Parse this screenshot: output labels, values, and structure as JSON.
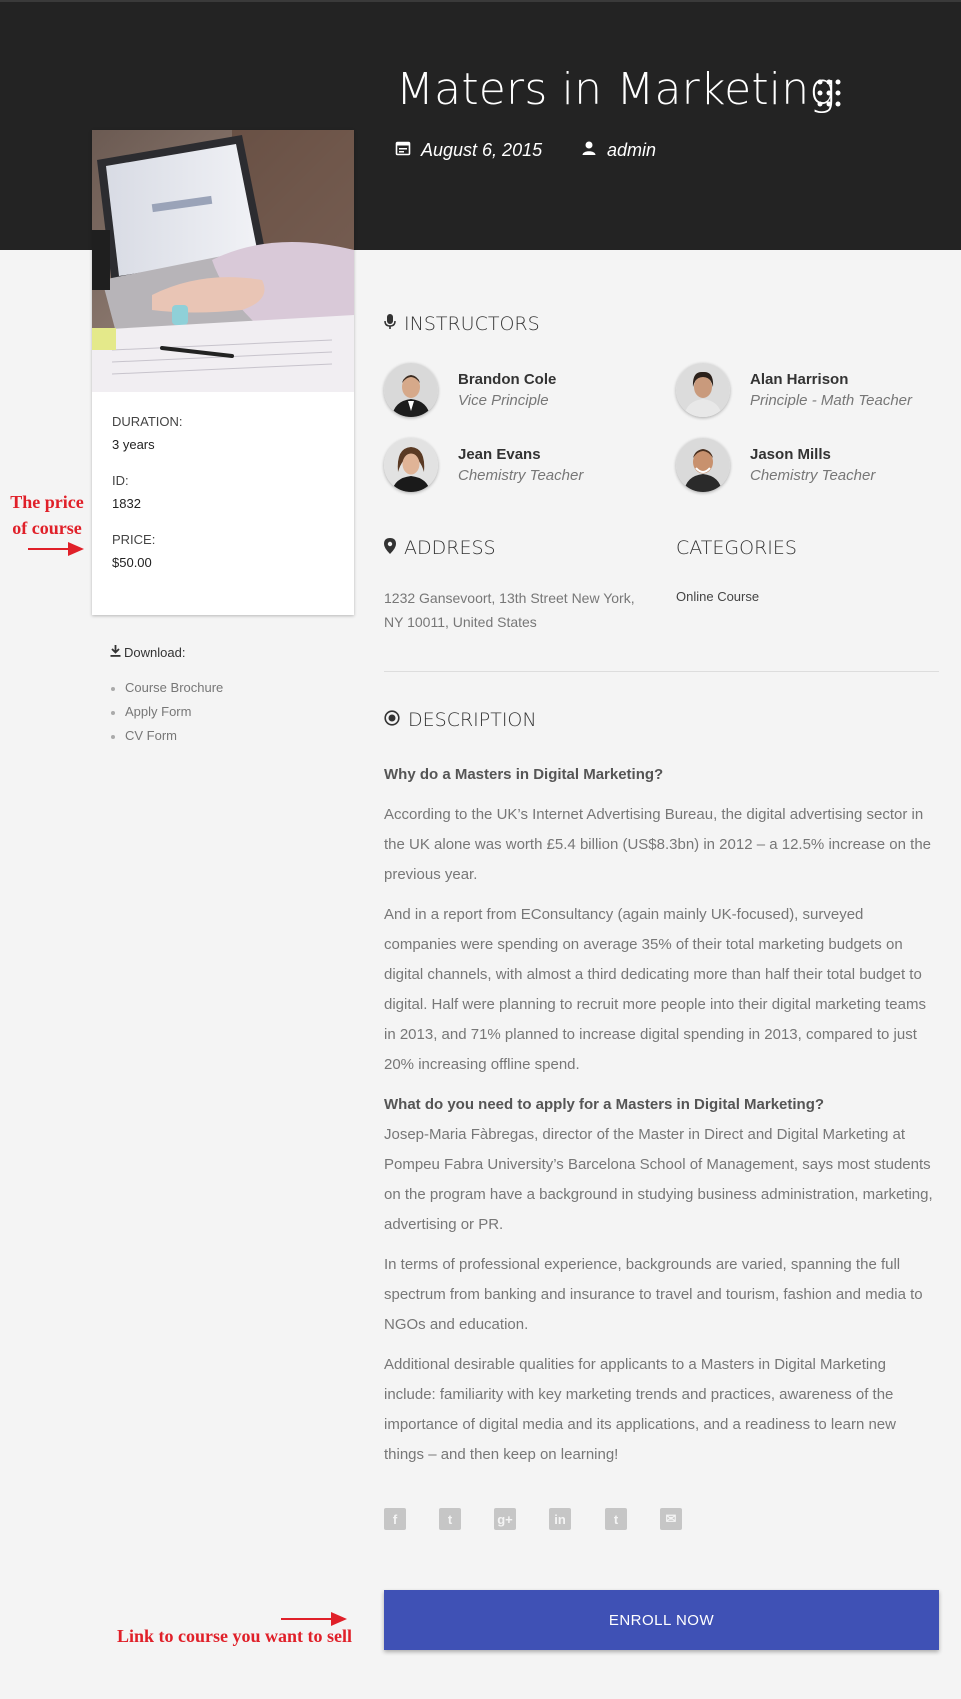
{
  "header": {
    "title": "Maters in Marketing",
    "date": "August 6, 2015",
    "author": "admin"
  },
  "course_card": {
    "duration_label": "DURATION:",
    "duration_value": "3 years",
    "id_label": "ID:",
    "id_value": "1832",
    "price_label": "PRICE:",
    "price_value": "$50.00"
  },
  "downloads": {
    "heading": "Download:",
    "items": [
      "Course Brochure",
      "Apply Form",
      "CV Form"
    ]
  },
  "instructors": {
    "heading": "INSTRUCTORS",
    "items": [
      {
        "name": "Brandon Cole",
        "role": "Vice Principle"
      },
      {
        "name": "Alan Harrison",
        "role": "Principle - Math Teacher"
      },
      {
        "name": "Jean Evans",
        "role": "Chemistry Teacher"
      },
      {
        "name": "Jason Mills",
        "role": "Chemistry Teacher"
      }
    ]
  },
  "address": {
    "heading": "ADDRESS",
    "text": "1232 Gansevoort, 13th Street New York, NY 10011, United States"
  },
  "categories": {
    "heading": "CATEGORIES",
    "value": "Online Course"
  },
  "description": {
    "heading": "DESCRIPTION",
    "q1": "Why do a Masters in Digital Marketing?",
    "p1": "According to the UK’s Internet Advertising Bureau, the digital advertising sector in the UK alone was worth £5.4 billion (US$8.3bn) in 2012 – a 12.5% increase on the previous year.",
    "p2": "And in a report from EConsultancy (again mainly UK-focused), surveyed companies were spending on average 35% of their total marketing budgets on digital channels, with almost a third dedicating more than half their total budget to digital. Half were planning to recruit more people into their digital marketing teams in 2013, and 71% planned to increase digital spending in 2013, compared to just 20% increasing offline spend.",
    "q2": "What do you need to apply for a Masters in Digital Marketing?",
    "p3": "Josep-Maria Fàbregas, director of the Master in Direct and Digital Marketing at Pompeu Fabra University’s Barcelona School of Management, says most students on the program have a background in studying business administration, marketing, advertising or PR.",
    "p4": "In terms of professional experience, backgrounds are varied, spanning the full spectrum from banking and insurance to travel and tourism, fashion and media to NGOs and education.",
    "p5": "Additional desirable qualities for applicants to a Masters in Digital Marketing include: familiarity with key marketing trends and practices, awareness of the importance of digital media and its applications, and a readiness to learn new things – and then keep on learning!"
  },
  "social": {
    "icons": [
      "facebook-icon",
      "twitter-icon",
      "google-plus-icon",
      "linkedin-icon",
      "tumblr-icon",
      "email-icon"
    ],
    "glyphs": [
      "f",
      "t",
      "g+",
      "in",
      "t",
      "✉"
    ]
  },
  "enroll": {
    "label": "ENROLL NOW",
    "color": "#3f51b5"
  },
  "annotations": {
    "price_line1": "The price",
    "price_line2": "of course",
    "link_note": "Link to course you want to sell"
  }
}
